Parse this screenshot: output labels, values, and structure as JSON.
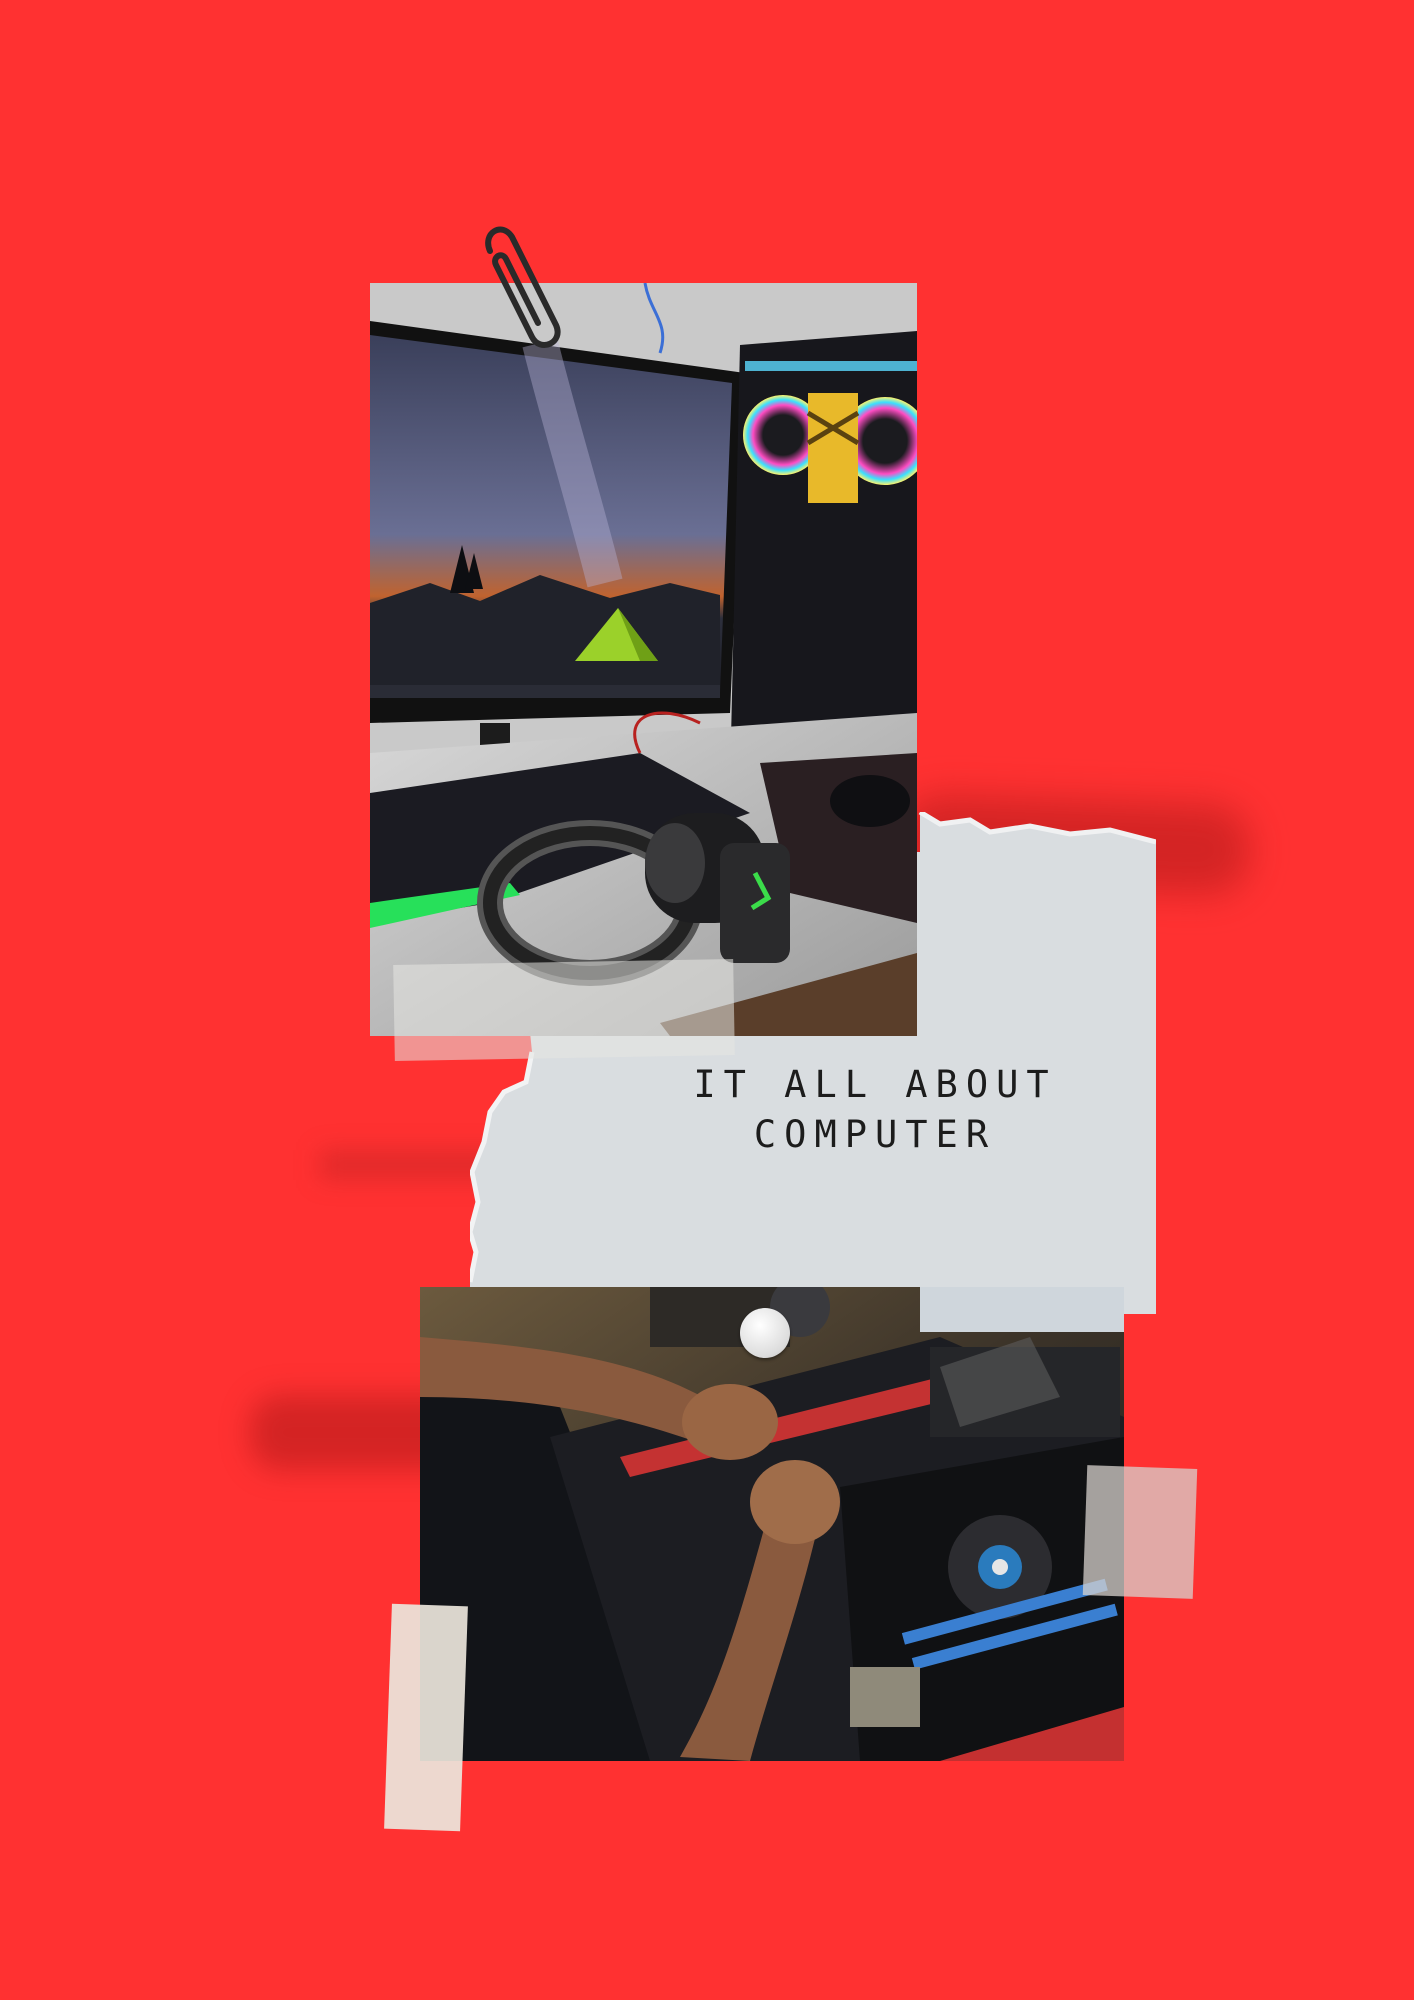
{
  "caption": {
    "line1": "IT ALL ABOUT",
    "line2": "COMPUTER"
  },
  "colors": {
    "background": "#ff3131",
    "paper": "#d9dde0",
    "caption_text": "#1c1c1c"
  },
  "images": {
    "top_photo": "gaming-pc-desk-photo",
    "bottom_photo": "pc-assembly-hands-photo"
  },
  "decorations": [
    "paperclip-icon",
    "push-pin-icon",
    "tape-strip",
    "torn-paper"
  ]
}
